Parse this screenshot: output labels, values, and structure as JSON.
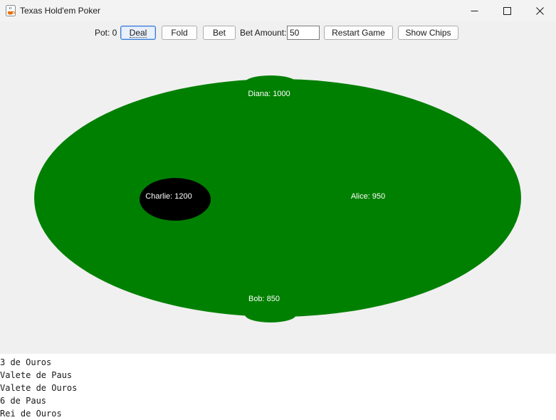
{
  "window": {
    "title": "Texas Hold'em Poker",
    "icon": "java-cup-icon",
    "controls": [
      "minimize-icon",
      "maximize-icon",
      "close-icon"
    ]
  },
  "toolbar": {
    "pot_label": "Pot: 0",
    "deal_label": "Deal",
    "fold_label": "Fold",
    "bet_label": "Bet",
    "bet_amount_label": "Bet Amount:",
    "bet_amount_value": "50",
    "restart_label": "Restart Game",
    "show_chips_label": "Show Chips"
  },
  "table": {
    "felt_color": "#008000",
    "background": "#f0f0f0",
    "players": [
      {
        "name": "Diana: 1000",
        "seat": "top"
      },
      {
        "name": "Charlie: 1200",
        "seat": "left",
        "active": true
      },
      {
        "name": "Alice: 950",
        "seat": "right"
      },
      {
        "name": "Bob: 850",
        "seat": "bottom"
      }
    ],
    "active_seat_color": "#000000"
  },
  "log": {
    "lines": [
      "3 de Ouros",
      "Valete de Paus",
      "Valete de Ouros",
      "6 de Paus",
      "Rei de Ouros"
    ]
  }
}
